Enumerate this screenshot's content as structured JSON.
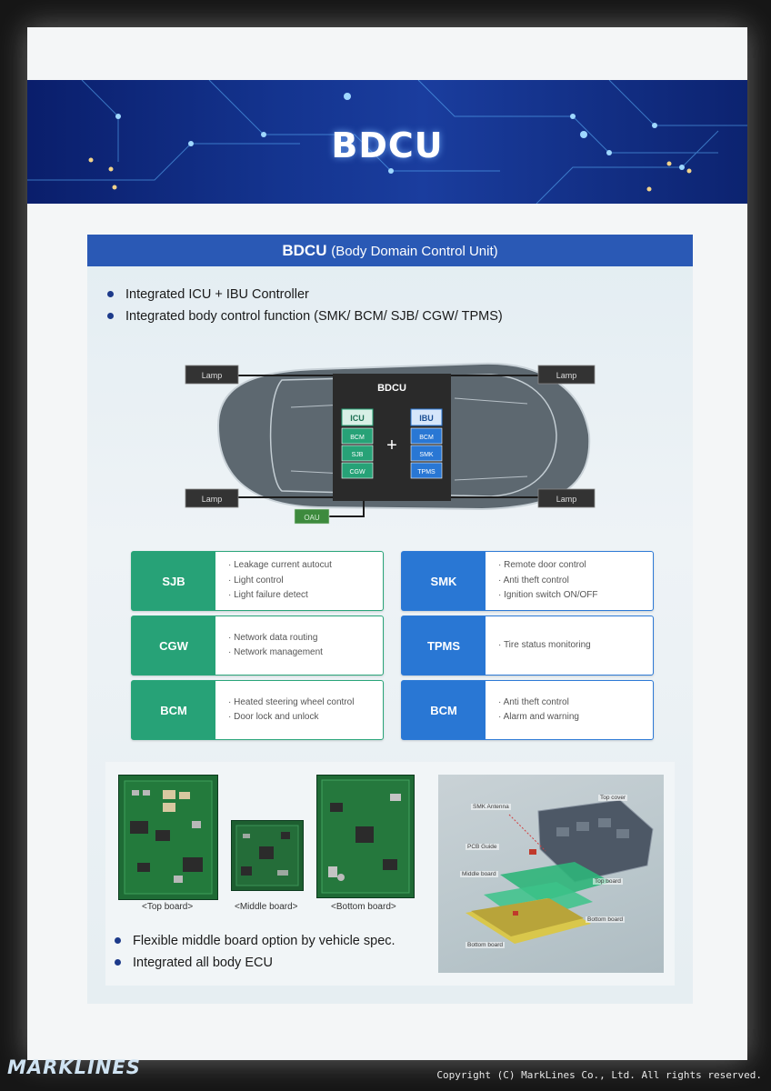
{
  "banner": {
    "title": "BDCU"
  },
  "panel": {
    "title_main": "BDCU",
    "title_sub": "(Body Domain Control Unit)",
    "bullets": [
      "Integrated ICU + IBU Controller",
      "Integrated body control function (SMK/ BCM/ SJB/ CGW/ TPMS)"
    ]
  },
  "diagram": {
    "lamp": "Lamp",
    "center": "BDCU",
    "icu": {
      "title": "ICU",
      "items": [
        "BCM",
        "SJB",
        "CGW"
      ]
    },
    "ibu": {
      "title": "IBU",
      "items": [
        "BCM",
        "SMK",
        "TPMS"
      ]
    },
    "plus": "+",
    "oau": "OAU"
  },
  "cards": [
    {
      "tag": "SJB",
      "items": [
        "Leakage current autocut",
        "Light control",
        "Light failure detect"
      ]
    },
    {
      "tag": "SMK",
      "items": [
        "Remote door control",
        "Anti theft control",
        "Ignition switch ON/OFF"
      ]
    },
    {
      "tag": "CGW",
      "items": [
        "Network data routing",
        "Network management"
      ]
    },
    {
      "tag": "TPMS",
      "items": [
        "Tire status monitoring"
      ]
    },
    {
      "tag": "BCM",
      "items": [
        "Heated steering wheel control",
        "Door lock and unlock"
      ]
    },
    {
      "tag": "BCM",
      "items": [
        "Anti theft control",
        "Alarm and warning"
      ]
    }
  ],
  "boards": {
    "captions": [
      "<Top board>",
      "<Middle board>",
      "<Bottom board>"
    ],
    "bullets": [
      "Flexible middle board option by vehicle spec.",
      "Integrated all body ECU"
    ]
  },
  "exploded": {
    "labels": [
      "Top cover",
      "SMK Antenna",
      "PCB Guide",
      "Middle board",
      "Top board",
      "Bottom board",
      "Bottom board"
    ]
  },
  "footer": {
    "logo": "MARKLINES",
    "copyright": "Copyright (C) MarkLines Co., Ltd. All rights reserved."
  },
  "colors": {
    "banner": "#14348f",
    "header": "#2a59b5",
    "green": "#27a277",
    "blue": "#2977d4"
  }
}
